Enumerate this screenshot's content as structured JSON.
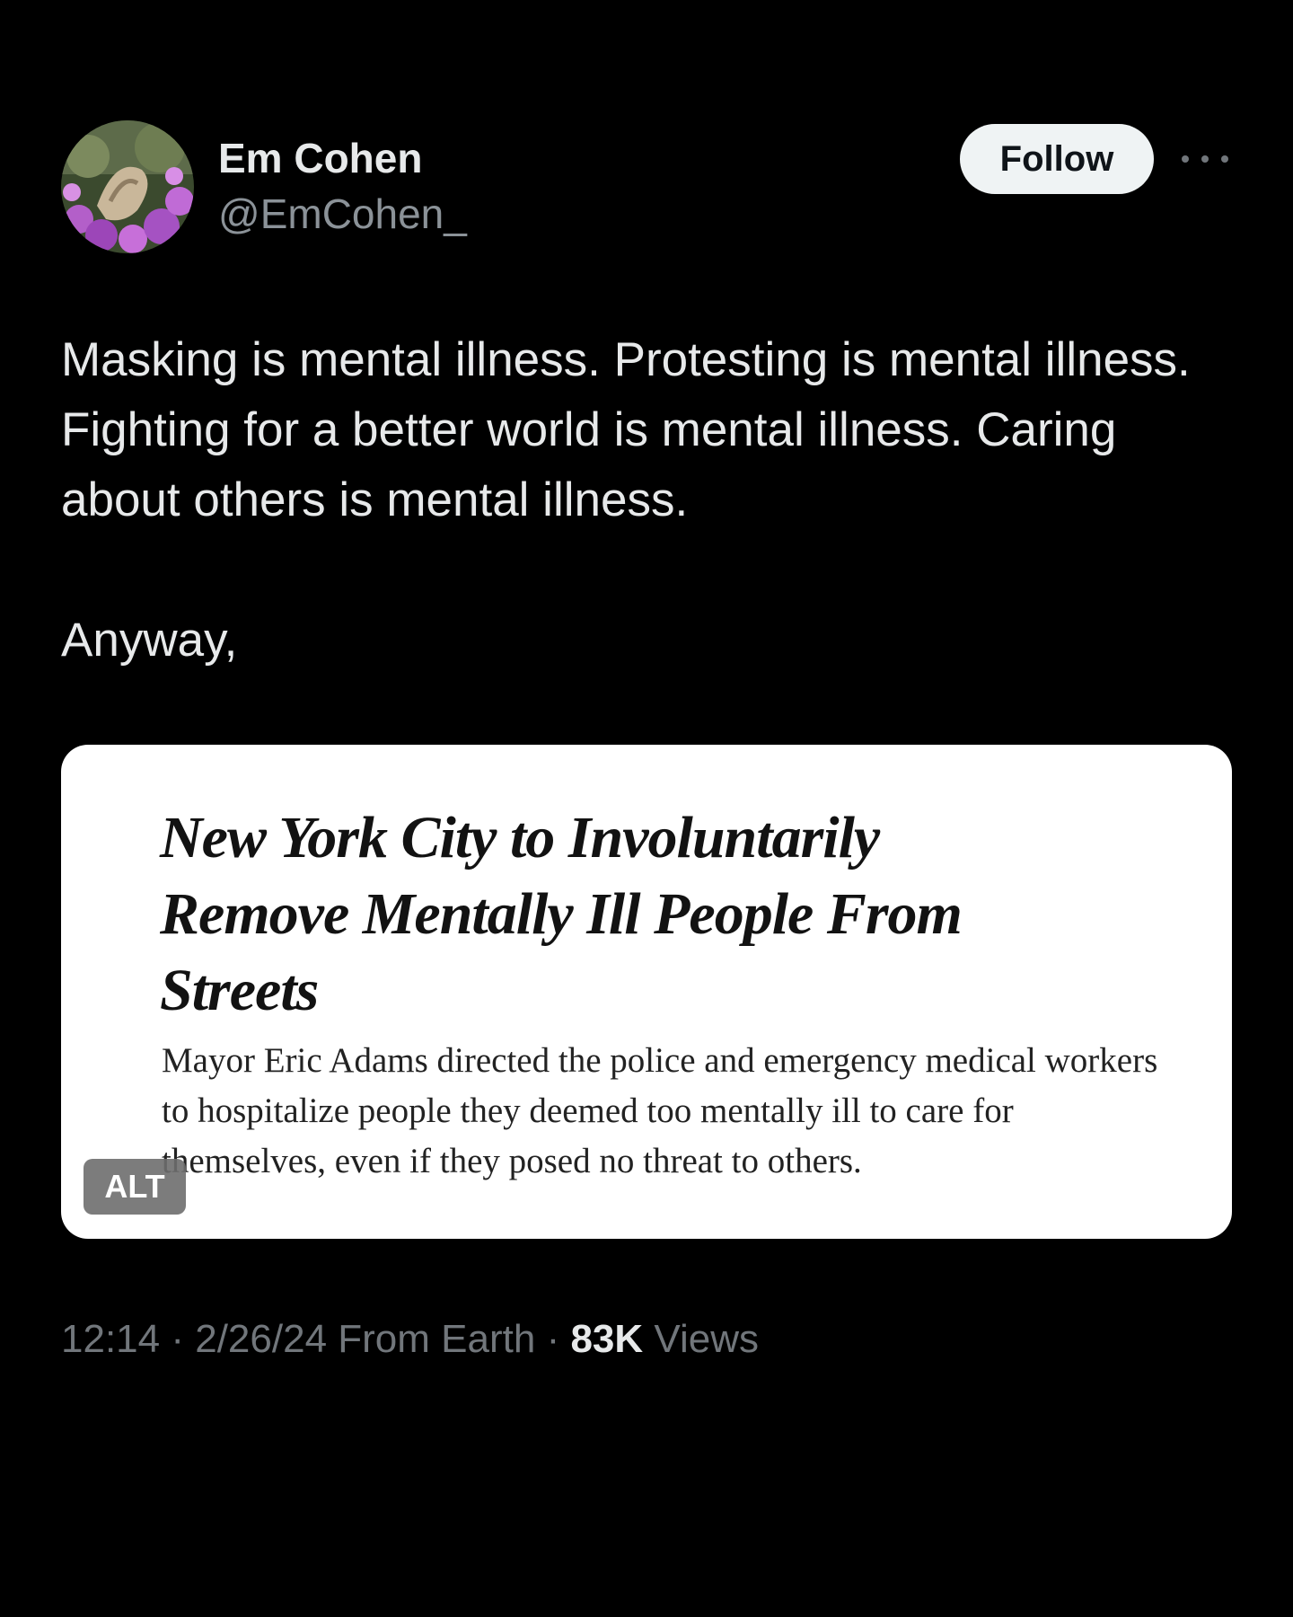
{
  "author": {
    "display_name": "Em Cohen",
    "handle": "@EmCohen_",
    "avatar_icon": "profile-photo-flowers"
  },
  "actions": {
    "follow_label": "Follow",
    "more_icon": "ellipsis-icon"
  },
  "tweet": {
    "paragraphs": [
      "Masking is mental illness. Protesting is mental illness. Fighting for a better world is mental illness. Caring about others is mental illness.",
      "Anyway,"
    ]
  },
  "media": {
    "headline": "New York City to Involuntarily Remove Mentally Ill People From Streets",
    "summary": "Mayor Eric Adams directed the police and emergency medical workers to hospitalize people they deemed too mentally ill to care for themselves, even if they posed no threat to others.",
    "alt_label": "ALT"
  },
  "meta": {
    "time": "12:14",
    "separator": "·",
    "date": "2/26/24",
    "source": "From Earth",
    "views_count": "83K",
    "views_label": "Views"
  },
  "colors": {
    "background": "#000000",
    "text_primary": "#e7e9ea",
    "text_secondary": "#71767b",
    "follow_button_bg": "#eff3f4"
  }
}
